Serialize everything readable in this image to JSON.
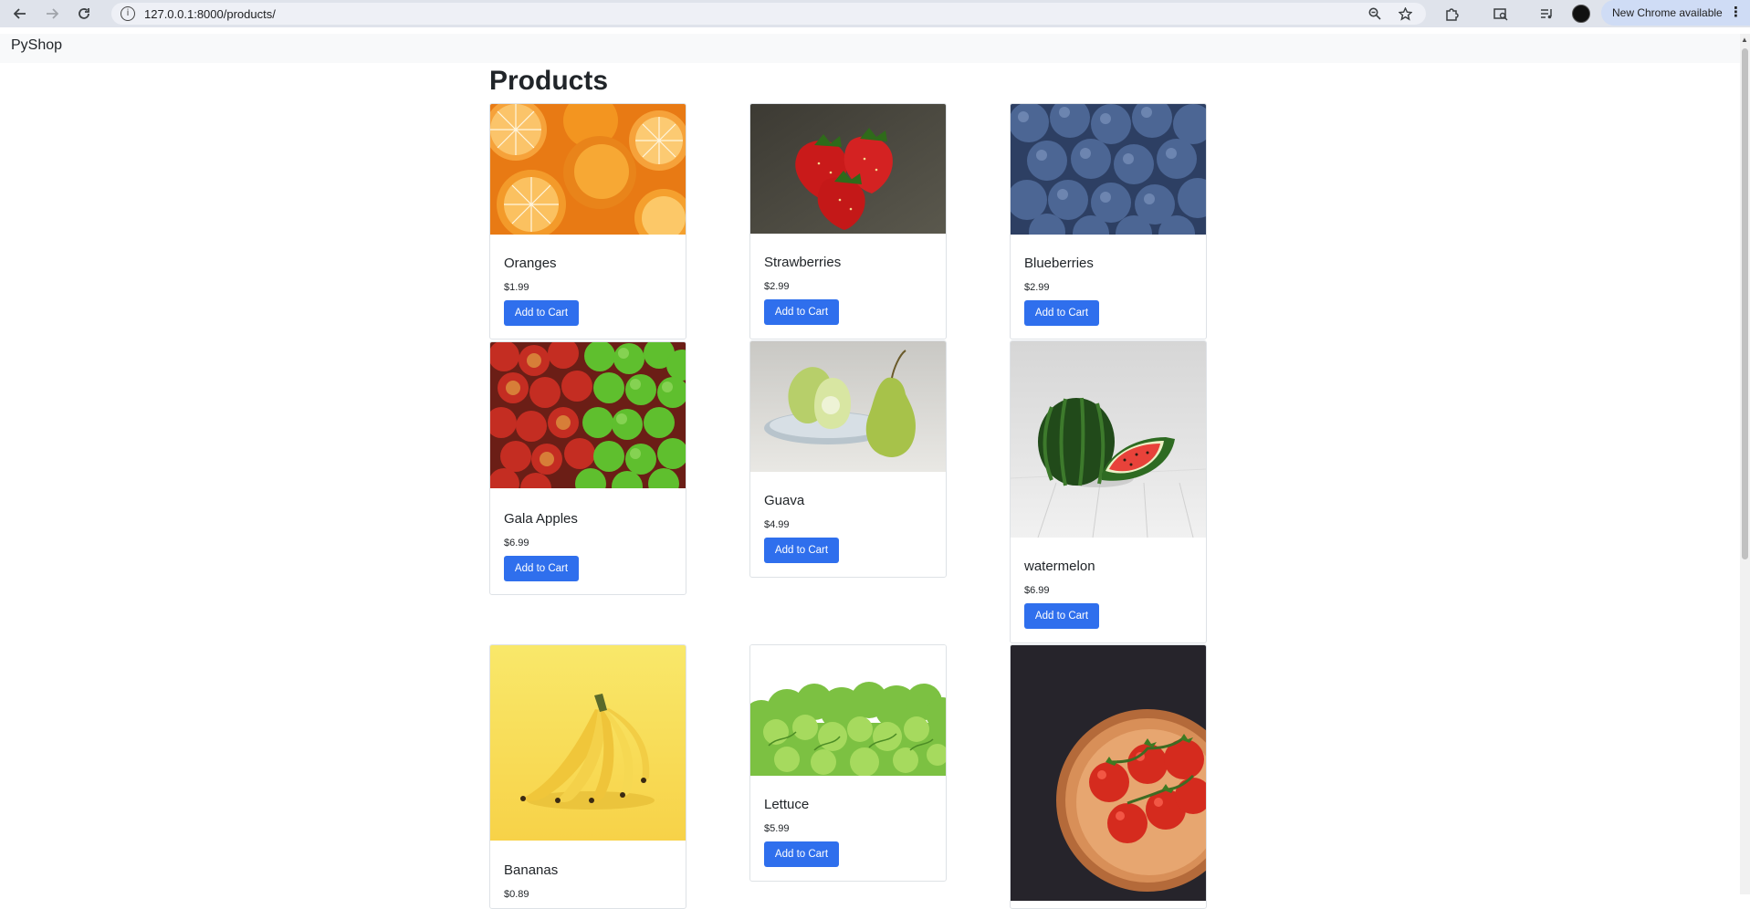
{
  "browser": {
    "url": "127.0.0.1:8000/products/",
    "update_label": "New Chrome available",
    "icons": {
      "back": "arrow-left-icon",
      "forward": "arrow-right-icon",
      "reload": "reload-icon",
      "site_info": "info-icon",
      "zoom": "zoom-icon",
      "bookmark": "star-icon",
      "extensions": "puzzle-icon",
      "tab_search": "tab-search-icon",
      "media": "media-controls-icon",
      "menu": "kebab-menu-icon"
    }
  },
  "navbar": {
    "brand": "PyShop"
  },
  "page": {
    "title": "Products",
    "add_to_cart_label": "Add to Cart"
  },
  "products": [
    {
      "name": "Oranges",
      "price": "$1.99"
    },
    {
      "name": "Strawberries",
      "price": "$2.99"
    },
    {
      "name": "Blueberries",
      "price": "$2.99"
    },
    {
      "name": "Gala Apples",
      "price": "$6.99"
    },
    {
      "name": "Guava",
      "price": "$4.99"
    },
    {
      "name": "watermelon",
      "price": "$6.99"
    },
    {
      "name": "Bananas",
      "price": "$0.89"
    },
    {
      "name": "Lettuce",
      "price": "$5.99"
    },
    {
      "name": "",
      "price": ""
    }
  ],
  "colors": {
    "button_primary": "#2f6fed",
    "navbar_bg": "#f8f9fa",
    "chrome_bg": "#dfe3eb"
  }
}
